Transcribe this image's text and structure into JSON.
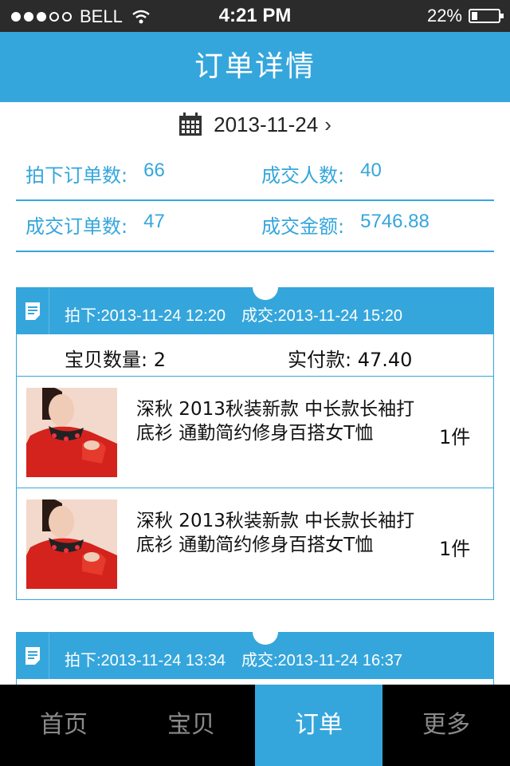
{
  "status": {
    "carrier": "BELL",
    "time": "4:21 PM",
    "battery": "22%",
    "battery_level": 0.22
  },
  "nav": {
    "title": "订单详情"
  },
  "date": {
    "value": "2013-11-24",
    "chevron": "›",
    "icon": "calendar-icon"
  },
  "stats": [
    {
      "label": "拍下订单数:",
      "value": "66"
    },
    {
      "label": "成交人数:",
      "value": "40"
    },
    {
      "label": "成交订单数:",
      "value": "47"
    },
    {
      "label": "成交金额:",
      "value": "5746.88"
    }
  ],
  "orders": [
    {
      "placed": "拍下:2013-11-24 12:20",
      "paid": "成交:2013-11-24 15:20",
      "count_label": "宝贝数量:",
      "count": "2",
      "pay_label": "实付款:",
      "pay": "47.40",
      "items": [
        {
          "title": "深秋 2013秋装新款 中长款长袖打底衫 通勤简约修身百搭女T恤",
          "qty": "1件"
        },
        {
          "title": "深秋 2013秋装新款 中长款长袖打底衫 通勤简约修身百搭女T恤",
          "qty": "1件"
        }
      ]
    },
    {
      "placed": "拍下:2013-11-24 13:34",
      "paid": "成交:2013-11-24 16:37"
    }
  ],
  "tabs": [
    {
      "label": "首页",
      "active": false
    },
    {
      "label": "宝贝",
      "active": false
    },
    {
      "label": "订单",
      "active": true
    },
    {
      "label": "更多",
      "active": false
    }
  ],
  "colors": {
    "accent": "#35a6dc",
    "statusbar": "#2b2b2b",
    "tabbar": "#000000"
  }
}
